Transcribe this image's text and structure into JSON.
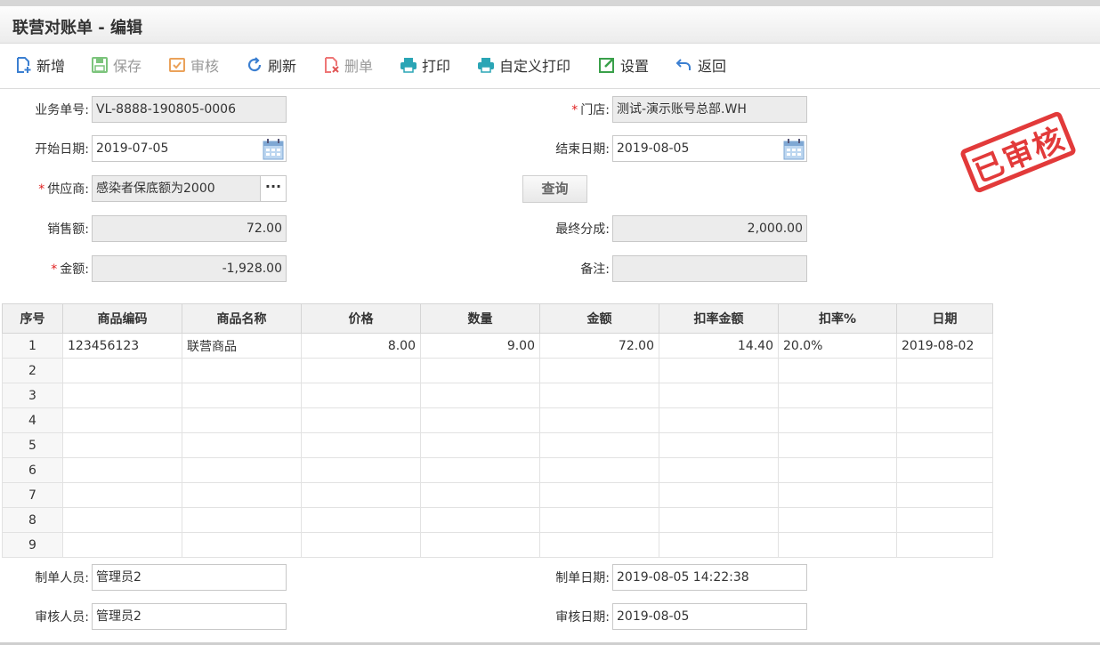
{
  "title": "联营对账单 - 编辑",
  "toolbar": [
    {
      "label": "新增",
      "icon": "add-doc-icon",
      "enabled": true,
      "color": "#3b7fd1"
    },
    {
      "label": "保存",
      "icon": "save-icon",
      "enabled": false,
      "color": "#5cb85c"
    },
    {
      "label": "审核",
      "icon": "audit-icon",
      "enabled": false,
      "color": "#e89b3c"
    },
    {
      "label": "刷新",
      "icon": "refresh-icon",
      "enabled": true,
      "color": "#3b7fd1"
    },
    {
      "label": "删单",
      "icon": "delete-doc-icon",
      "enabled": false,
      "color": "#e05555"
    },
    {
      "label": "打印",
      "icon": "printer-icon",
      "enabled": true,
      "color": "#2aa5b5"
    },
    {
      "label": "自定义打印",
      "icon": "printer-icon",
      "enabled": true,
      "color": "#2aa5b5"
    },
    {
      "label": "设置",
      "icon": "edit-settings-icon",
      "enabled": true,
      "color": "#3aa04a"
    },
    {
      "label": "返回",
      "icon": "back-arrow-icon",
      "enabled": true,
      "color": "#3b7fd1"
    }
  ],
  "form": {
    "doc_no_label": "业务单号:",
    "doc_no": "VL-8888-190805-0006",
    "store_label": "门店:",
    "store": "测试-演示账号总部.WH",
    "start_date_label": "开始日期:",
    "start_date": "2019-07-05",
    "end_date_label": "结束日期:",
    "end_date": "2019-08-05",
    "supplier_label": "供应商:",
    "supplier": "感染者保底额为2000",
    "query_label": "查询",
    "sales_label": "销售额:",
    "sales": "72.00",
    "final_share_label": "最终分成:",
    "final_share": "2,000.00",
    "amount_label": "金额:",
    "amount": "-1,928.00",
    "remark_label": "备注:",
    "remark": ""
  },
  "stamp": "已审核",
  "table": {
    "headers": [
      "序号",
      "商品编码",
      "商品名称",
      "价格",
      "数量",
      "金额",
      "扣率金额",
      "扣率%",
      "日期"
    ],
    "rows": [
      [
        "1",
        "123456123",
        "联营商品",
        "8.00",
        "9.00",
        "72.00",
        "14.40",
        "20.0%",
        "2019-08-02"
      ],
      [
        "2",
        "",
        "",
        "",
        "",
        "",
        "",
        "",
        ""
      ],
      [
        "3",
        "",
        "",
        "",
        "",
        "",
        "",
        "",
        ""
      ],
      [
        "4",
        "",
        "",
        "",
        "",
        "",
        "",
        "",
        ""
      ],
      [
        "5",
        "",
        "",
        "",
        "",
        "",
        "",
        "",
        ""
      ],
      [
        "6",
        "",
        "",
        "",
        "",
        "",
        "",
        "",
        ""
      ],
      [
        "7",
        "",
        "",
        "",
        "",
        "",
        "",
        "",
        ""
      ],
      [
        "8",
        "",
        "",
        "",
        "",
        "",
        "",
        "",
        ""
      ],
      [
        "9",
        "",
        "",
        "",
        "",
        "",
        "",
        "",
        ""
      ]
    ]
  },
  "footer": {
    "creator_label": "制单人员:",
    "creator": "管理员2",
    "create_date_label": "制单日期:",
    "create_date": "2019-08-05 14:22:38",
    "auditor_label": "审核人员:",
    "auditor": "管理员2",
    "audit_date_label": "审核日期:",
    "audit_date": "2019-08-05"
  }
}
